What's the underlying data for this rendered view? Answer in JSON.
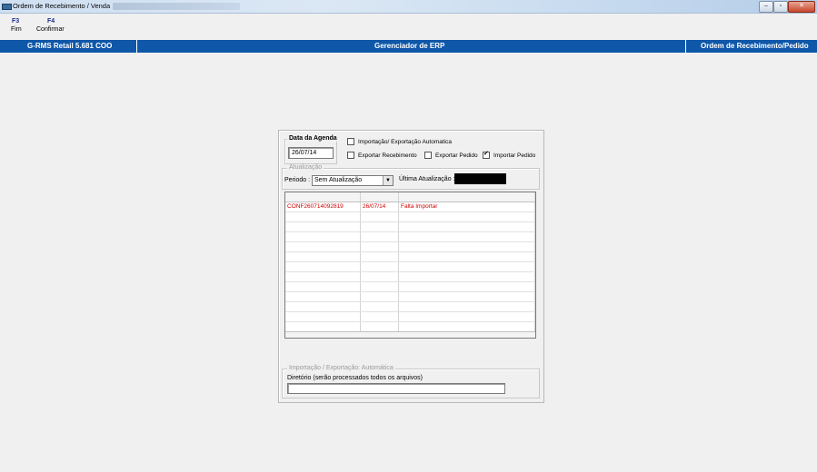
{
  "window": {
    "title": "Ordem de Recebimento / Venda"
  },
  "toolbar": [
    {
      "key": "F3",
      "label": "Fim"
    },
    {
      "key": "F4",
      "label": "Confirmar"
    }
  ],
  "header": {
    "left": "G-RMS Retail 5.681 COO",
    "center": "Gerenciador de ERP",
    "right": "Ordem de Recebimento/Pedido"
  },
  "form": {
    "agenda": {
      "title": "Data da Agenda",
      "value": "26/07/14"
    },
    "options": {
      "auto_import_export": {
        "label": "Importação/ Exportação Automatica",
        "checked": false
      },
      "exportar_recebimento": {
        "label": "Exportar Recebimento",
        "checked": false
      },
      "exportar_pedido": {
        "label": "Exportar Pedido",
        "checked": false
      },
      "importar_pedido": {
        "label": "Importar Pedido",
        "checked": true
      }
    },
    "atualizacao": {
      "title": "Atualização",
      "periodo_label": "Periodo :",
      "periodo_value": "Sem Atualização",
      "ultima_label": "Última Atualização :"
    },
    "grid": {
      "rows": [
        {
          "codigo": "CONF260714092819",
          "data": "26/07/14",
          "status": "Falta Importar"
        }
      ]
    },
    "auto_section": {
      "title": "Importação / Exportação: Automática",
      "dir_label": "Diretório (serão processados todos os arquivos)",
      "dir_value": ""
    }
  },
  "colors": {
    "header_blue": "#0f57a8",
    "row_text": "#d10000",
    "fkey": "#1a2e8c"
  }
}
